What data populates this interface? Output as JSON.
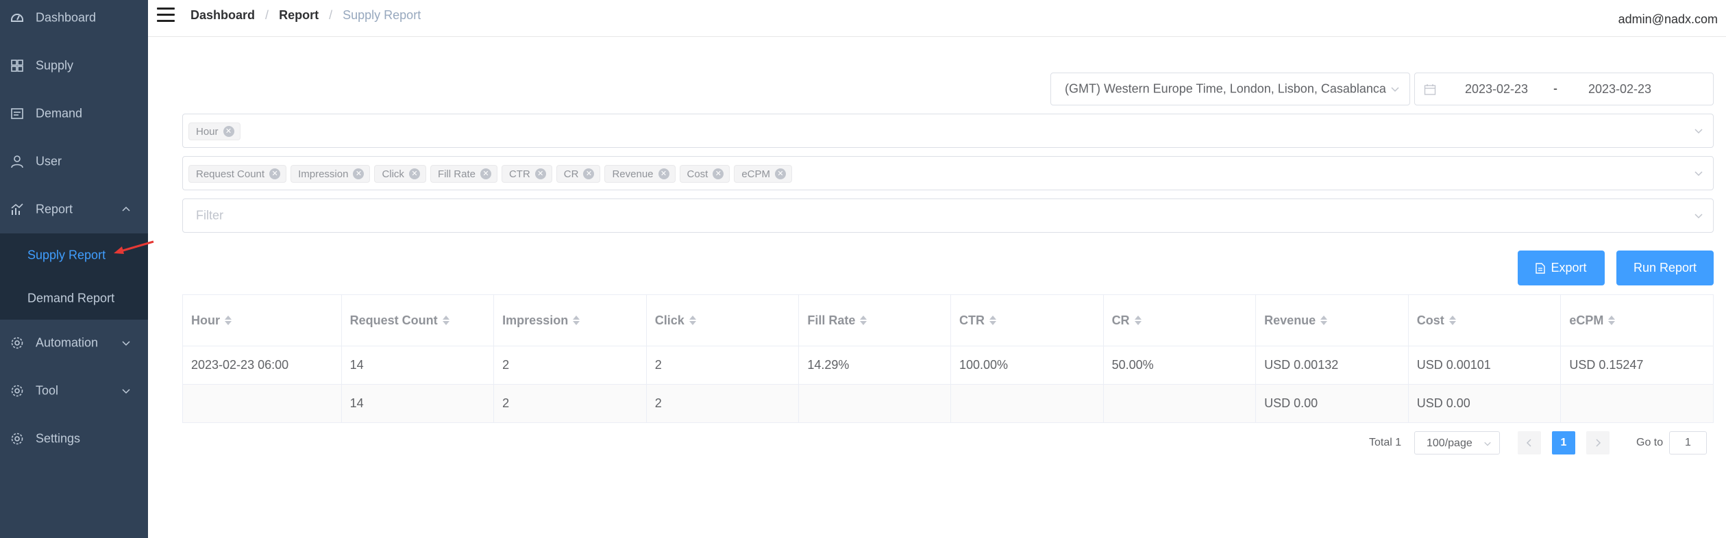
{
  "sidebar": {
    "items": [
      {
        "label": "Dashboard",
        "icon": "dashboard-icon"
      },
      {
        "label": "Supply",
        "icon": "supply-icon"
      },
      {
        "label": "Demand",
        "icon": "demand-icon"
      },
      {
        "label": "User",
        "icon": "user-icon"
      },
      {
        "label": "Report",
        "icon": "chart-icon"
      },
      {
        "label": "Automation",
        "icon": "gear-icon"
      },
      {
        "label": "Tool",
        "icon": "gear-icon"
      },
      {
        "label": "Settings",
        "icon": "gear-icon"
      }
    ],
    "report_children": [
      {
        "label": "Supply Report",
        "active": true
      },
      {
        "label": "Demand Report",
        "active": false
      }
    ]
  },
  "header": {
    "breadcrumb": [
      "Dashboard",
      "Report",
      "Supply Report"
    ],
    "separator": "/",
    "user": "admin@nadx.com"
  },
  "filters": {
    "timezone": "(GMT) Western Europe Time, London, Lisbon, Casablanca",
    "date_start": "2023-02-23",
    "date_end": "2023-02-23",
    "date_sep": "-",
    "dimensions": [
      "Hour"
    ],
    "metrics": [
      "Request Count",
      "Impression",
      "Click",
      "Fill Rate",
      "CTR",
      "CR",
      "Revenue",
      "Cost",
      "eCPM"
    ],
    "filter_placeholder": "Filter"
  },
  "actions": {
    "export_label": "Export",
    "run_label": "Run Report"
  },
  "table": {
    "columns": [
      "Hour",
      "Request Count",
      "Impression",
      "Click",
      "Fill Rate",
      "CTR",
      "CR",
      "Revenue",
      "Cost",
      "eCPM"
    ],
    "rows": [
      [
        "2023-02-23 06:00",
        "14",
        "2",
        "2",
        "14.29%",
        "100.00%",
        "50.00%",
        "USD 0.00132",
        "USD 0.00101",
        "USD 0.15247"
      ],
      [
        "",
        "14",
        "2",
        "2",
        "",
        "",
        "",
        "USD 0.00",
        "USD 0.00",
        ""
      ]
    ]
  },
  "pagination": {
    "total": "Total 1",
    "page_size": "100/page",
    "current_page": "1",
    "goto_label": "Go to",
    "goto_value": "1"
  },
  "colors": {
    "sidebar_bg": "#304156",
    "submenu_bg": "#1f2d3d",
    "accent": "#409eff",
    "annotation_arrow": "#e53935"
  }
}
